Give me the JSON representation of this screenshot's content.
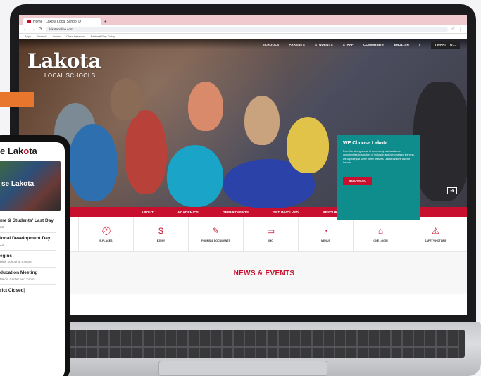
{
  "browser": {
    "tab_title": "Home - Lakota Local School D",
    "new_tab": "+",
    "url": "lakotaonline.com",
    "bookmarks": [
      "Apps",
      "Phoenix",
      "Vortex",
      "Class Intercom",
      "National Day Today"
    ]
  },
  "site": {
    "logo_text": "Lakota",
    "logo_sub": "LOCAL SCHOOLS",
    "nav": [
      "SCHOOLS",
      "PARENTS",
      "STUDENTS",
      "STAFF",
      "COMMUNITY",
      "ENGLISH"
    ],
    "want_button": "I WANT TO...",
    "callout": {
      "title": "WE Choose Lakota",
      "body": "From the strong sense of community and academic opportunities to a culture of inclusion and personalized learning, we capture just some of the reasons Lakota families choose Lakota.",
      "button": "WATCH VIDEO"
    },
    "menu": [
      "ABOUT",
      "ACADEMICS",
      "DEPARTMENTS",
      "GET INVOLVED",
      "RESOURCES"
    ],
    "quick_links": [
      {
        "icon": "backpack-icon",
        "glyph": "⛑",
        "label": "E-PLACES"
      },
      {
        "icon": "dollar-icon",
        "glyph": "$",
        "label": "EZPAY"
      },
      {
        "icon": "document-icon",
        "glyph": "✎",
        "label": "FORMS & DOCUMENTS"
      },
      {
        "icon": "computer-icon",
        "glyph": "▭",
        "label": "IMC"
      },
      {
        "icon": "apple-icon",
        "glyph": "◔",
        "label": "MENUS"
      },
      {
        "icon": "lock-icon",
        "glyph": "⌂",
        "label": "ONE LOGIN"
      },
      {
        "icon": "warning-icon",
        "glyph": "⚠",
        "label": "SAFETY HOTLINE"
      }
    ],
    "news_title": "NEWS & EVENTS"
  },
  "phone": {
    "title_prefix": "e Lak",
    "title_accent": "o",
    "title_suffix": "ta",
    "image_text": "se Lakota",
    "items": [
      {
        "title": "me & Students' Last Day",
        "sub": "23"
      },
      {
        "title": "ional Development Day",
        "sub": "23"
      },
      {
        "title": "egins",
        "sub": "High School at 8:00am"
      },
      {
        "title": "ducation Meeting",
        "sub": "Media Center and Zoom"
      },
      {
        "title": "rict Closed)",
        "sub": ""
      }
    ]
  },
  "colors": {
    "brand_red": "#c8102e",
    "teal": "#0f8c8c",
    "orange": "#e8762d"
  }
}
